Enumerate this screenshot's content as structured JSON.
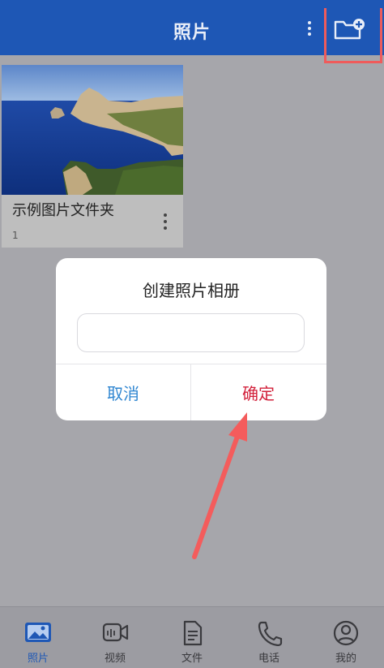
{
  "header": {
    "title": "照片",
    "more_icon": "more-vertical-icon",
    "new_album_icon": "folder-plus-icon",
    "bg_color": "#1e57b5"
  },
  "albums": [
    {
      "name": "示例图片文件夹",
      "count": "1",
      "thumbnail": "coastal-cliff-sea-photo"
    }
  ],
  "dialog": {
    "title": "创建照片相册",
    "input_value": "",
    "input_placeholder": "",
    "cancel_label": "取消",
    "confirm_label": "确定",
    "cancel_color": "#2f86d1",
    "confirm_color": "#d2203a"
  },
  "annotation": {
    "highlight_color": "#ef5b5b"
  },
  "bottom_nav": {
    "active": "照片",
    "items": [
      {
        "label": "照片",
        "icon": "image-icon"
      },
      {
        "label": "视频",
        "icon": "video-camera-icon"
      },
      {
        "label": "文件",
        "icon": "document-icon"
      },
      {
        "label": "电话",
        "icon": "phone-icon"
      },
      {
        "label": "我的",
        "icon": "user-circle-icon"
      }
    ]
  }
}
